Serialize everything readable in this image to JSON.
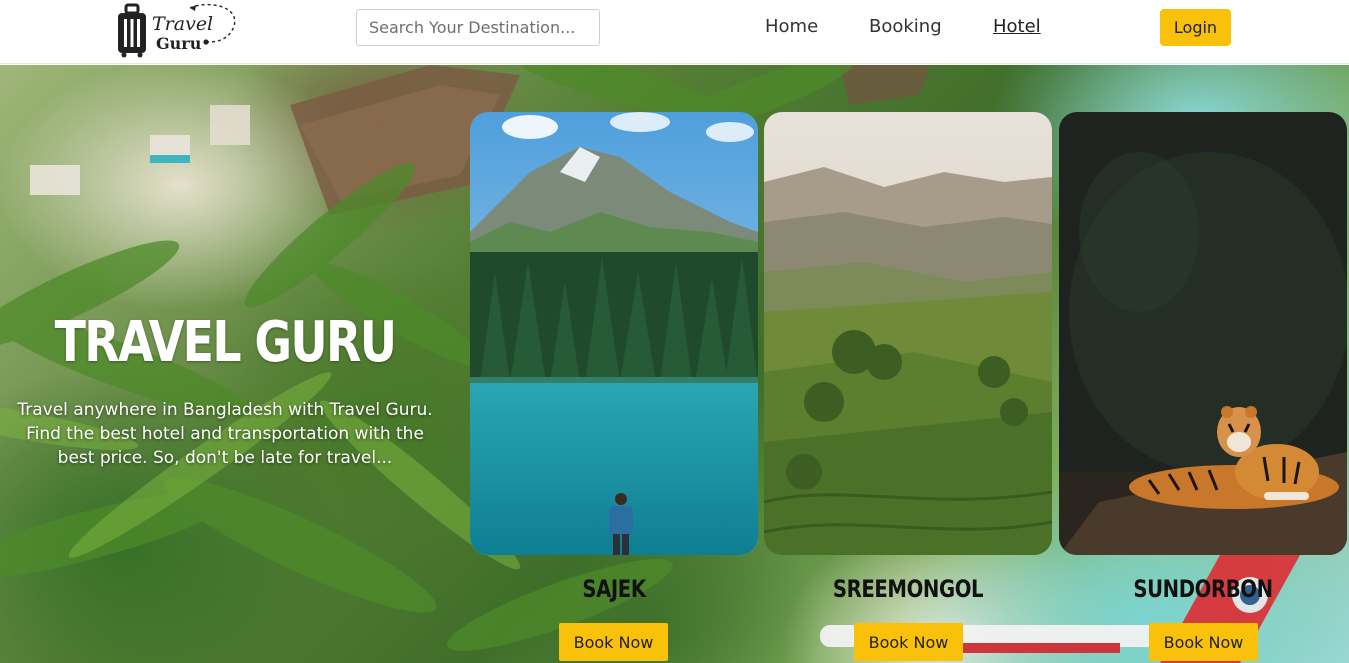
{
  "brand": {
    "logo_line1": "Travel",
    "logo_line2": "Guru",
    "logo_icon": "suitcase-icon"
  },
  "header": {
    "search_placeholder": "Search Your Destination...",
    "nav": [
      {
        "label": "Home",
        "active": false
      },
      {
        "label": "Booking",
        "active": false
      },
      {
        "label": "Hotel",
        "active": true
      }
    ],
    "login_label": "Login"
  },
  "hero": {
    "title": "TRAVEL GURU",
    "description": "Travel anywhere in Bangladesh with Travel Guru. Find the best hotel and transportation with the best price. So, don't be late for travel..."
  },
  "destinations": [
    {
      "name": "SAJEK",
      "button": "Book Now",
      "image": "mountain-lake-photo"
    },
    {
      "name": "SREEMONGOL",
      "button": "Book Now",
      "image": "tea-hills-photo"
    },
    {
      "name": "SUNDORBON",
      "button": "Book Now",
      "image": "tiger-forest-photo"
    }
  ],
  "colors": {
    "accent": "#f9c10a",
    "text_dark": "#222222",
    "white": "#ffffff"
  }
}
